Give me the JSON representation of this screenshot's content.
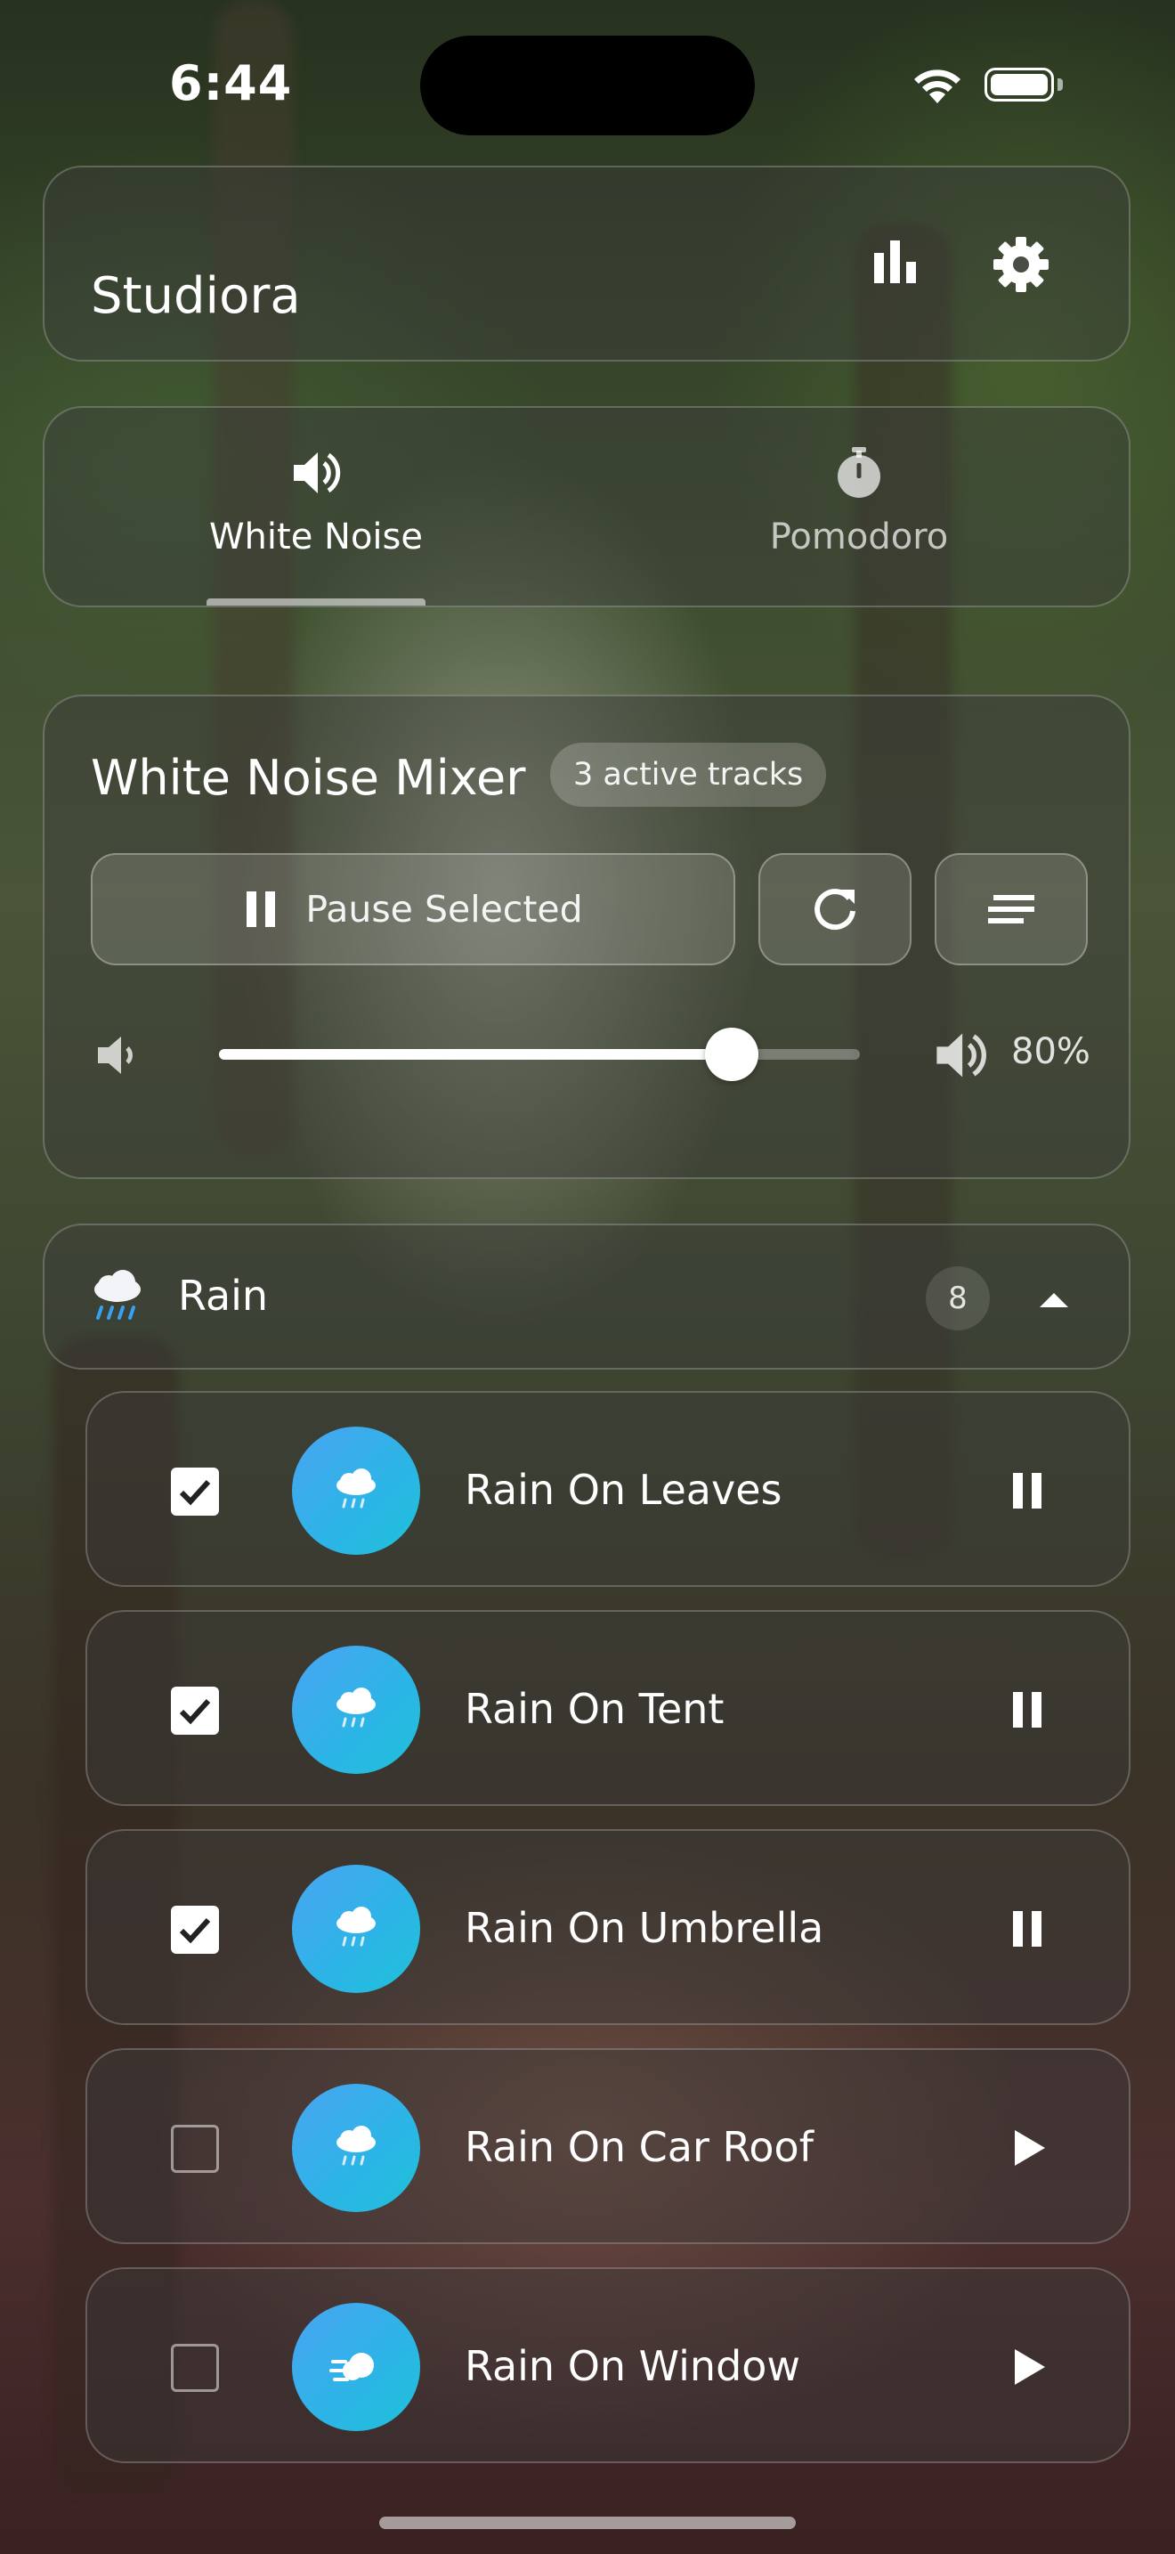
{
  "status_bar": {
    "time": "6:44",
    "wifi_icon": "wifi-icon",
    "battery_icon": "battery-icon"
  },
  "header": {
    "title": "Studiora",
    "icons": [
      "bar-chart-icon",
      "gear-icon"
    ]
  },
  "tabs": [
    {
      "label": "White Noise",
      "icon": "speaker-icon",
      "active": true
    },
    {
      "label": "Pomodoro",
      "icon": "stopwatch-icon",
      "active": false
    }
  ],
  "mixer": {
    "title": "White Noise Mixer",
    "active_badge": "3 active tracks",
    "pause_label": "Pause Selected",
    "volume_percent": 80,
    "volume_label": "80%"
  },
  "category": {
    "emoji": "🌧️",
    "label": "Rain",
    "count": "8",
    "expanded": true
  },
  "tracks": [
    {
      "name": "Rain On Leaves",
      "checked": true,
      "playing": true,
      "icon": "rain-cloud-icon"
    },
    {
      "name": "Rain On Tent",
      "checked": true,
      "playing": true,
      "icon": "rain-cloud-icon"
    },
    {
      "name": "Rain On Umbrella",
      "checked": true,
      "playing": true,
      "icon": "rain-cloud-icon"
    },
    {
      "name": "Rain On Car Roof",
      "checked": false,
      "playing": false,
      "icon": "rain-cloud-icon"
    },
    {
      "name": "Rain On Window",
      "checked": false,
      "playing": false,
      "icon": "wind-icon"
    }
  ],
  "colors": {
    "accent_gradient_start": "#4aa4f2",
    "accent_gradient_end": "#1fc2d8"
  }
}
